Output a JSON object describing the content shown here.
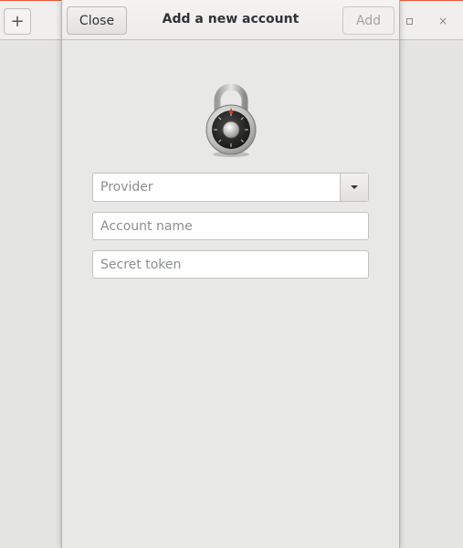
{
  "background_window": {
    "add_button_label": "+",
    "maximize_icon": "maximize-icon",
    "close_label": "×"
  },
  "dialog": {
    "title": "Add a new account",
    "close_label": "Close",
    "add_label": "Add",
    "icon": "lock-icon"
  },
  "form": {
    "provider": {
      "placeholder": "Provider",
      "value": ""
    },
    "account_name": {
      "placeholder": "Account name",
      "value": ""
    },
    "secret_token": {
      "placeholder": "Secret token",
      "value": ""
    }
  },
  "colors": {
    "accent": "#e8583a",
    "window_bg": "#e8e8e7",
    "disabled_text": "#a2a49f",
    "placeholder_text": "#8b8e8f"
  }
}
